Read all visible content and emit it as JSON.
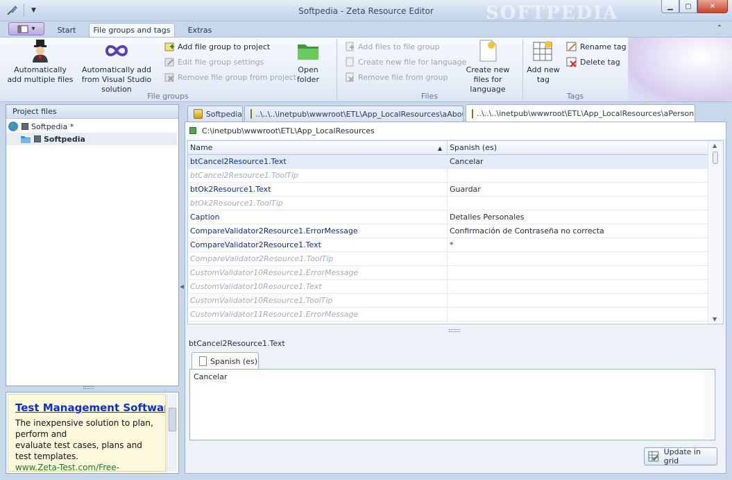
{
  "window": {
    "title": "Softpedia - Zeta Resource Editor",
    "watermark": "SOFTPEDIA"
  },
  "ribbon": {
    "tabs": [
      {
        "label": "Start",
        "active": false
      },
      {
        "label": "File groups and tags",
        "active": true
      },
      {
        "label": "Extras",
        "active": false
      }
    ],
    "groups": {
      "file_groups": {
        "label": "File groups",
        "auto_add_multiple": "Automatically add multiple files",
        "auto_add_vs": "Automatically add from Visual Studio solution",
        "add_group": "Add file group to project",
        "edit_group": "Edit file group settings",
        "remove_group": "Remove file group from project",
        "open_folder": "Open folder"
      },
      "files": {
        "label": "Files",
        "add_files": "Add files to file group",
        "create_new_file": "Create new file for language",
        "remove_file": "Remove file from group",
        "create_new_files": "Create new files for language"
      },
      "tags": {
        "label": "Tags",
        "add_new_tag": "Add new tag",
        "rename_tag": "Rename tag",
        "delete_tag": "Delete tag"
      }
    }
  },
  "left_panel": {
    "header": "Project files",
    "tree": [
      {
        "label": "Softpedia *",
        "level": 0,
        "bold": false
      },
      {
        "label": "Softpedia",
        "level": 1,
        "bold": true
      }
    ]
  },
  "ad": {
    "title": "Test Management Software",
    "body_line1": "The inexpensive solution to plan, perform and",
    "body_line2": "evaluate test cases, plans and test templates.",
    "url": "www.Zeta-Test.com/Free-"
  },
  "doc_tabs": [
    {
      "label": "Softpedia",
      "active": false
    },
    {
      "label": "..\\..\\..\\inetpub\\wwwroot\\ETL\\App_LocalResources\\aAbout",
      "active": false
    },
    {
      "label": "..\\..\\..\\inetpub\\wwwroot\\ETL\\App_LocalResources\\aPersonal",
      "active": true
    }
  ],
  "path": "C:\\inetpub\\wwwroot\\ETL\\App_LocalResources",
  "grid": {
    "columns": [
      "Name",
      "Spanish (es)"
    ],
    "rows": [
      {
        "name": "btCancel2Resource1.Text",
        "value": "Cancelar",
        "empty": false
      },
      {
        "name": "btCancel2Resource1.ToolTip",
        "value": "",
        "empty": true
      },
      {
        "name": "btOk2Resource1.Text",
        "value": "Guardar",
        "empty": false
      },
      {
        "name": "btOk2Resource1.ToolTip",
        "value": "",
        "empty": true
      },
      {
        "name": "Caption",
        "value": "Detalles Personales",
        "empty": false
      },
      {
        "name": "CompareValidator2Resource1.ErrorMessage",
        "value": "Confirmación de Contraseña no correcta",
        "empty": false
      },
      {
        "name": "CompareValidator2Resource1.Text",
        "value": "*",
        "empty": false
      },
      {
        "name": "CompareValidator2Resource1.ToolTip",
        "value": "",
        "empty": true
      },
      {
        "name": "CustomValidator10Resource1.ErrorMessage",
        "value": "",
        "empty": true
      },
      {
        "name": "CustomValidator10Resource1.Text",
        "value": "",
        "empty": true
      },
      {
        "name": "CustomValidator10Resource1.ToolTip",
        "value": "",
        "empty": true
      },
      {
        "name": "CustomValidator11Resource1.ErrorMessage",
        "value": "",
        "empty": true
      }
    ]
  },
  "editor": {
    "caption": "btCancel2Resource1.Text",
    "tab": "Spanish (es)",
    "text": "Cancelar",
    "update_button": "Update in grid"
  },
  "colors": {
    "accent": "#a7bcd8",
    "selection": "#e2ebf7",
    "ad_title": "#0b2fd0",
    "ad_url": "#1c7a1c"
  }
}
